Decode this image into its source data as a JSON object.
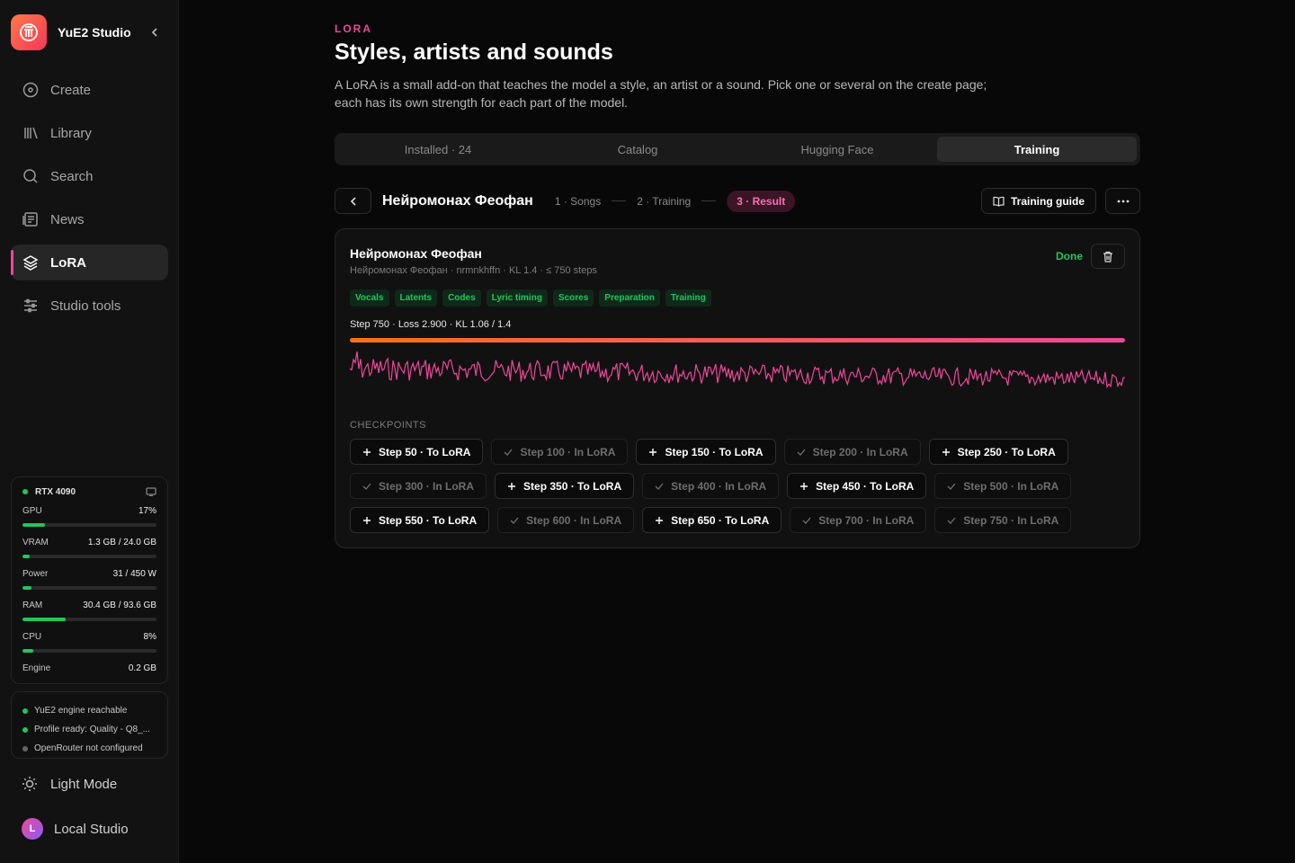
{
  "app": {
    "name": "YuE2 Studio"
  },
  "nav": [
    {
      "label": "Create",
      "icon": "disc-icon",
      "active": false
    },
    {
      "label": "Library",
      "icon": "library-icon",
      "active": false
    },
    {
      "label": "Search",
      "icon": "search-icon",
      "active": false
    },
    {
      "label": "News",
      "icon": "news-icon",
      "active": false
    },
    {
      "label": "LoRA",
      "icon": "layers-icon",
      "active": true
    },
    {
      "label": "Studio tools",
      "icon": "sliders-icon",
      "active": false
    }
  ],
  "system": {
    "gpu_name": "RTX 4090",
    "rows": [
      {
        "label": "GPU",
        "value": "17%",
        "fraction": 0.17
      },
      {
        "label": "VRAM",
        "value": "1.3 GB / 24.0 GB",
        "fraction": 0.054
      },
      {
        "label": "Power",
        "value": "31 / 450 W",
        "fraction": 0.069
      },
      {
        "label": "RAM",
        "value": "30.4 GB / 93.6 GB",
        "fraction": 0.325
      },
      {
        "label": "CPU",
        "value": "8%",
        "fraction": 0.08
      }
    ],
    "engine_label": "Engine",
    "engine_value": "0.2 GB"
  },
  "status": [
    {
      "text": "YuE2 engine reachable",
      "ok": true
    },
    {
      "text": "Profile ready: Quality - Q8_...",
      "ok": true
    },
    {
      "text": "OpenRouter not configured",
      "ok": false
    }
  ],
  "footer": {
    "theme_label": "Light Mode",
    "profile_label": "Local Studio",
    "avatar_letter": "L"
  },
  "page": {
    "eyebrow": "LORA",
    "title": "Styles, artists and sounds",
    "description": "A LoRA is a small add-on that teaches the model a style, an artist or a sound. Pick one or several on the create page; each has its own strength for each part of the model."
  },
  "tabs": [
    {
      "label": "Installed · 24",
      "active": false
    },
    {
      "label": "Catalog",
      "active": false
    },
    {
      "label": "Hugging Face",
      "active": false
    },
    {
      "label": "Training",
      "active": true
    }
  ],
  "stepper": {
    "lora_name": "Нейромонах Феофан",
    "steps": [
      "1 · Songs",
      "2 · Training",
      "3 · Result"
    ],
    "current": 2,
    "guide_label": "Training guide"
  },
  "job": {
    "title": "Нейромонах Феофан",
    "subtitle": "Нейромонах Феофан · nrmnkhffn · KL 1.4 · ≤ 750 steps",
    "status": "Done",
    "stages": [
      "Vocals",
      "Latents",
      "Codes",
      "Lyric timing",
      "Scores",
      "Preparation",
      "Training"
    ],
    "progress_label": "Step 750 · Loss 2.900 · KL 1.06 / 1.4",
    "progress": 1.0,
    "checkpoints_label": "CHECKPOINTS",
    "checkpoints": [
      {
        "label": "Step 50 · To LoRA",
        "in_lora": false
      },
      {
        "label": "Step 100 · In LoRA",
        "in_lora": true
      },
      {
        "label": "Step 150 · To LoRA",
        "in_lora": false
      },
      {
        "label": "Step 200 · In LoRA",
        "in_lora": true
      },
      {
        "label": "Step 250 · To LoRA",
        "in_lora": false
      },
      {
        "label": "Step 300 · In LoRA",
        "in_lora": true
      },
      {
        "label": "Step 350 · To LoRA",
        "in_lora": false
      },
      {
        "label": "Step 400 · In LoRA",
        "in_lora": true
      },
      {
        "label": "Step 450 · To LoRA",
        "in_lora": false
      },
      {
        "label": "Step 500 · In LoRA",
        "in_lora": true
      },
      {
        "label": "Step 550 · To LoRA",
        "in_lora": false
      },
      {
        "label": "Step 600 · In LoRA",
        "in_lora": true
      },
      {
        "label": "Step 650 · To LoRA",
        "in_lora": false
      },
      {
        "label": "Step 700 · In LoRA",
        "in_lora": true
      },
      {
        "label": "Step 750 · In LoRA",
        "in_lora": true
      }
    ]
  },
  "colors": {
    "accent": "#ec4899",
    "ok": "#22c55e",
    "progress_start": "#f97316",
    "progress_end": "#ec4899"
  }
}
